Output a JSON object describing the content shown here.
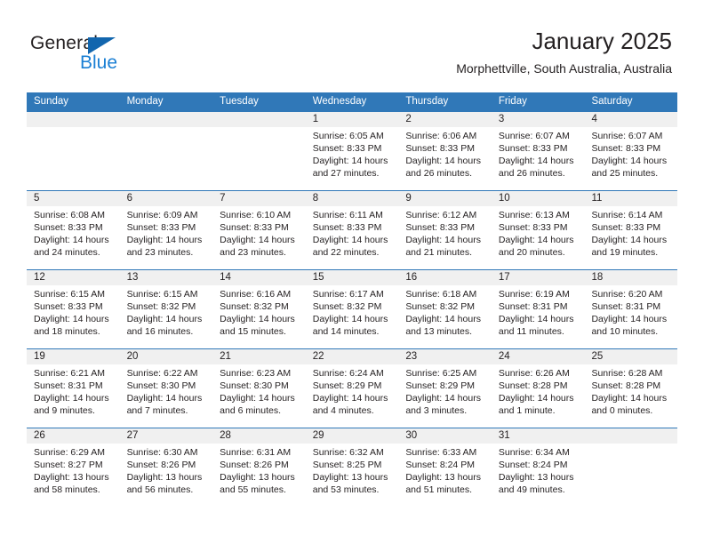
{
  "brand": {
    "name_part1": "General",
    "name_part2": "Blue",
    "accent_color": "#1a7fd4",
    "triangle_color": "#1266ae"
  },
  "header": {
    "title": "January 2025",
    "subtitle": "Morphettville, South Australia, Australia"
  },
  "theme": {
    "header_bar_color": "#3078b8",
    "daynum_band_color": "#f0f0f0",
    "text_color": "#231f20"
  },
  "weekday_headers": [
    "Sunday",
    "Monday",
    "Tuesday",
    "Wednesday",
    "Thursday",
    "Friday",
    "Saturday"
  ],
  "weeks": [
    [
      {
        "day": "",
        "sunrise": "",
        "sunset": "",
        "daylight1": "",
        "daylight2": "",
        "empty": true
      },
      {
        "day": "",
        "sunrise": "",
        "sunset": "",
        "daylight1": "",
        "daylight2": "",
        "empty": true
      },
      {
        "day": "",
        "sunrise": "",
        "sunset": "",
        "daylight1": "",
        "daylight2": "",
        "empty": true
      },
      {
        "day": "1",
        "sunrise": "Sunrise: 6:05 AM",
        "sunset": "Sunset: 8:33 PM",
        "daylight1": "Daylight: 14 hours",
        "daylight2": "and 27 minutes."
      },
      {
        "day": "2",
        "sunrise": "Sunrise: 6:06 AM",
        "sunset": "Sunset: 8:33 PM",
        "daylight1": "Daylight: 14 hours",
        "daylight2": "and 26 minutes."
      },
      {
        "day": "3",
        "sunrise": "Sunrise: 6:07 AM",
        "sunset": "Sunset: 8:33 PM",
        "daylight1": "Daylight: 14 hours",
        "daylight2": "and 26 minutes."
      },
      {
        "day": "4",
        "sunrise": "Sunrise: 6:07 AM",
        "sunset": "Sunset: 8:33 PM",
        "daylight1": "Daylight: 14 hours",
        "daylight2": "and 25 minutes."
      }
    ],
    [
      {
        "day": "5",
        "sunrise": "Sunrise: 6:08 AM",
        "sunset": "Sunset: 8:33 PM",
        "daylight1": "Daylight: 14 hours",
        "daylight2": "and 24 minutes."
      },
      {
        "day": "6",
        "sunrise": "Sunrise: 6:09 AM",
        "sunset": "Sunset: 8:33 PM",
        "daylight1": "Daylight: 14 hours",
        "daylight2": "and 23 minutes."
      },
      {
        "day": "7",
        "sunrise": "Sunrise: 6:10 AM",
        "sunset": "Sunset: 8:33 PM",
        "daylight1": "Daylight: 14 hours",
        "daylight2": "and 23 minutes."
      },
      {
        "day": "8",
        "sunrise": "Sunrise: 6:11 AM",
        "sunset": "Sunset: 8:33 PM",
        "daylight1": "Daylight: 14 hours",
        "daylight2": "and 22 minutes."
      },
      {
        "day": "9",
        "sunrise": "Sunrise: 6:12 AM",
        "sunset": "Sunset: 8:33 PM",
        "daylight1": "Daylight: 14 hours",
        "daylight2": "and 21 minutes."
      },
      {
        "day": "10",
        "sunrise": "Sunrise: 6:13 AM",
        "sunset": "Sunset: 8:33 PM",
        "daylight1": "Daylight: 14 hours",
        "daylight2": "and 20 minutes."
      },
      {
        "day": "11",
        "sunrise": "Sunrise: 6:14 AM",
        "sunset": "Sunset: 8:33 PM",
        "daylight1": "Daylight: 14 hours",
        "daylight2": "and 19 minutes."
      }
    ],
    [
      {
        "day": "12",
        "sunrise": "Sunrise: 6:15 AM",
        "sunset": "Sunset: 8:33 PM",
        "daylight1": "Daylight: 14 hours",
        "daylight2": "and 18 minutes."
      },
      {
        "day": "13",
        "sunrise": "Sunrise: 6:15 AM",
        "sunset": "Sunset: 8:32 PM",
        "daylight1": "Daylight: 14 hours",
        "daylight2": "and 16 minutes."
      },
      {
        "day": "14",
        "sunrise": "Sunrise: 6:16 AM",
        "sunset": "Sunset: 8:32 PM",
        "daylight1": "Daylight: 14 hours",
        "daylight2": "and 15 minutes."
      },
      {
        "day": "15",
        "sunrise": "Sunrise: 6:17 AM",
        "sunset": "Sunset: 8:32 PM",
        "daylight1": "Daylight: 14 hours",
        "daylight2": "and 14 minutes."
      },
      {
        "day": "16",
        "sunrise": "Sunrise: 6:18 AM",
        "sunset": "Sunset: 8:32 PM",
        "daylight1": "Daylight: 14 hours",
        "daylight2": "and 13 minutes."
      },
      {
        "day": "17",
        "sunrise": "Sunrise: 6:19 AM",
        "sunset": "Sunset: 8:31 PM",
        "daylight1": "Daylight: 14 hours",
        "daylight2": "and 11 minutes."
      },
      {
        "day": "18",
        "sunrise": "Sunrise: 6:20 AM",
        "sunset": "Sunset: 8:31 PM",
        "daylight1": "Daylight: 14 hours",
        "daylight2": "and 10 minutes."
      }
    ],
    [
      {
        "day": "19",
        "sunrise": "Sunrise: 6:21 AM",
        "sunset": "Sunset: 8:31 PM",
        "daylight1": "Daylight: 14 hours",
        "daylight2": "and 9 minutes."
      },
      {
        "day": "20",
        "sunrise": "Sunrise: 6:22 AM",
        "sunset": "Sunset: 8:30 PM",
        "daylight1": "Daylight: 14 hours",
        "daylight2": "and 7 minutes."
      },
      {
        "day": "21",
        "sunrise": "Sunrise: 6:23 AM",
        "sunset": "Sunset: 8:30 PM",
        "daylight1": "Daylight: 14 hours",
        "daylight2": "and 6 minutes."
      },
      {
        "day": "22",
        "sunrise": "Sunrise: 6:24 AM",
        "sunset": "Sunset: 8:29 PM",
        "daylight1": "Daylight: 14 hours",
        "daylight2": "and 4 minutes."
      },
      {
        "day": "23",
        "sunrise": "Sunrise: 6:25 AM",
        "sunset": "Sunset: 8:29 PM",
        "daylight1": "Daylight: 14 hours",
        "daylight2": "and 3 minutes."
      },
      {
        "day": "24",
        "sunrise": "Sunrise: 6:26 AM",
        "sunset": "Sunset: 8:28 PM",
        "daylight1": "Daylight: 14 hours",
        "daylight2": "and 1 minute."
      },
      {
        "day": "25",
        "sunrise": "Sunrise: 6:28 AM",
        "sunset": "Sunset: 8:28 PM",
        "daylight1": "Daylight: 14 hours",
        "daylight2": "and 0 minutes."
      }
    ],
    [
      {
        "day": "26",
        "sunrise": "Sunrise: 6:29 AM",
        "sunset": "Sunset: 8:27 PM",
        "daylight1": "Daylight: 13 hours",
        "daylight2": "and 58 minutes."
      },
      {
        "day": "27",
        "sunrise": "Sunrise: 6:30 AM",
        "sunset": "Sunset: 8:26 PM",
        "daylight1": "Daylight: 13 hours",
        "daylight2": "and 56 minutes."
      },
      {
        "day": "28",
        "sunrise": "Sunrise: 6:31 AM",
        "sunset": "Sunset: 8:26 PM",
        "daylight1": "Daylight: 13 hours",
        "daylight2": "and 55 minutes."
      },
      {
        "day": "29",
        "sunrise": "Sunrise: 6:32 AM",
        "sunset": "Sunset: 8:25 PM",
        "daylight1": "Daylight: 13 hours",
        "daylight2": "and 53 minutes."
      },
      {
        "day": "30",
        "sunrise": "Sunrise: 6:33 AM",
        "sunset": "Sunset: 8:24 PM",
        "daylight1": "Daylight: 13 hours",
        "daylight2": "and 51 minutes."
      },
      {
        "day": "31",
        "sunrise": "Sunrise: 6:34 AM",
        "sunset": "Sunset: 8:24 PM",
        "daylight1": "Daylight: 13 hours",
        "daylight2": "and 49 minutes."
      },
      {
        "day": "",
        "sunrise": "",
        "sunset": "",
        "daylight1": "",
        "daylight2": "",
        "empty": true
      }
    ]
  ]
}
